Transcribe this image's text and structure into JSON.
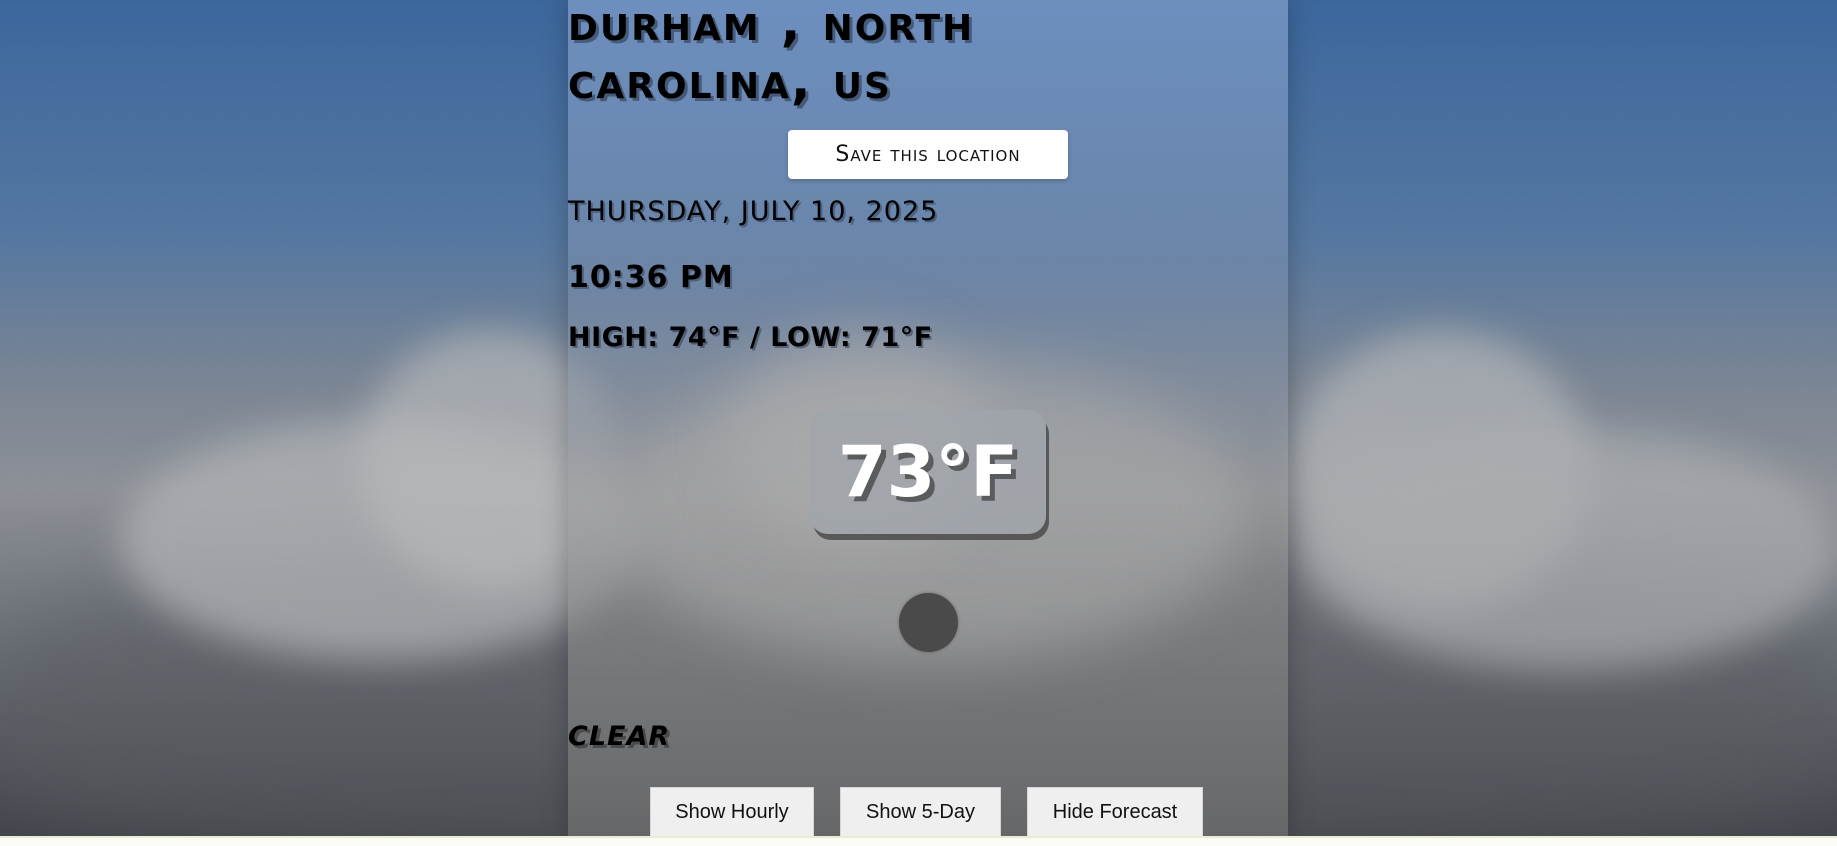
{
  "location": {
    "line1": "Durham , North",
    "line2": "Carolina, US"
  },
  "save_button": {
    "label": "Save this location"
  },
  "date": "THURSDAY, JULY 10, 2025",
  "time": "10:36 PM",
  "high_low": "HIGH: 74°F / LOW: 71°F",
  "temperature": "73°F",
  "weather_icon": "weather-icon",
  "condition": "Clear",
  "buttons": {
    "hourly": "Show Hourly",
    "five_day": "Show 5-Day",
    "forecast": "Hide Forecast"
  }
}
